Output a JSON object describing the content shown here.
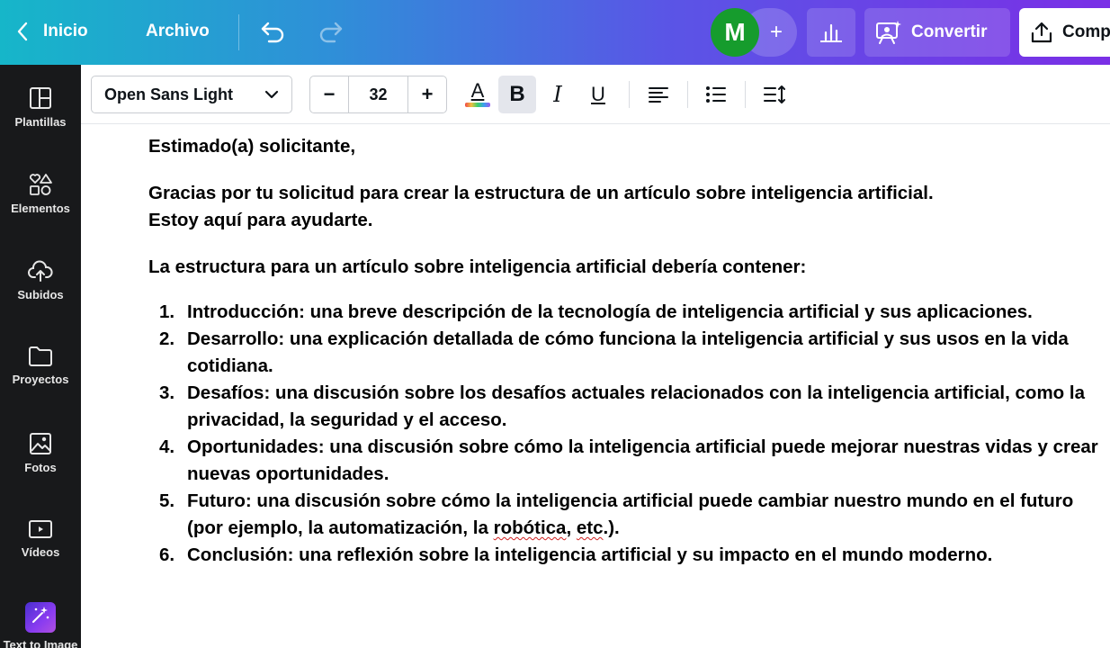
{
  "header": {
    "back_label": "Inicio",
    "file_label": "Archivo",
    "avatar_initial": "M",
    "add_label": "+",
    "convert_label": "Convertir",
    "share_label": "Comp"
  },
  "sidebar": {
    "items": [
      {
        "label": "Plantillas"
      },
      {
        "label": "Elementos"
      },
      {
        "label": "Subidos"
      },
      {
        "label": "Proyectos"
      },
      {
        "label": "Fotos"
      },
      {
        "label": "Vídeos"
      },
      {
        "label": "Text to Image"
      }
    ]
  },
  "toolbar": {
    "font_name": "Open Sans Light",
    "size_minus": "−",
    "font_size": "32",
    "size_plus": "+",
    "text_color_letter": "A",
    "bold_label": "B",
    "italic_label": "I",
    "underline_label": "U"
  },
  "document": {
    "greeting": "Estimado(a) solicitante,",
    "intro_line1": "Gracias por tu solicitud para crear la estructura de un artículo sobre inteligencia artificial.",
    "intro_line2": "Estoy aquí para ayudarte.",
    "lead": "La estructura para un artículo sobre inteligencia artificial debería contener:",
    "items": [
      {
        "num": "1.",
        "text": "Introducción: una breve descripción de la tecnología de inteligencia artificial y sus aplicaciones."
      },
      {
        "num": "2.",
        "text": "Desarrollo: una explicación detallada de cómo funciona la inteligencia artificial y sus usos en la vida cotidiana."
      },
      {
        "num": "3.",
        "text": "Desafíos: una discusión sobre los desafíos actuales relacionados con la inteligencia artificial, como la privacidad, la seguridad y el acceso."
      },
      {
        "num": "4.",
        "text": "Oportunidades: una discusión sobre cómo la inteligencia artificial puede mejorar nuestras vidas y crear nuevas oportunidades."
      },
      {
        "num": "5.",
        "text_before": "Futuro: una discusión sobre cómo la inteligencia artificial puede cambiar nuestro mundo en el futuro (por ejemplo, la automatización, la ",
        "misspelled1": "robótica",
        "text_mid": ", ",
        "misspelled2": "etc",
        "text_after": ".)."
      },
      {
        "num": "6.",
        "text": "Conclusión: una reflexión sobre la inteligencia artificial y su impacto en el mundo moderno."
      }
    ]
  },
  "colors": {
    "avatar": "#169c2d",
    "sidebar_bg": "#18191b",
    "spellcheck": "#d02020"
  }
}
